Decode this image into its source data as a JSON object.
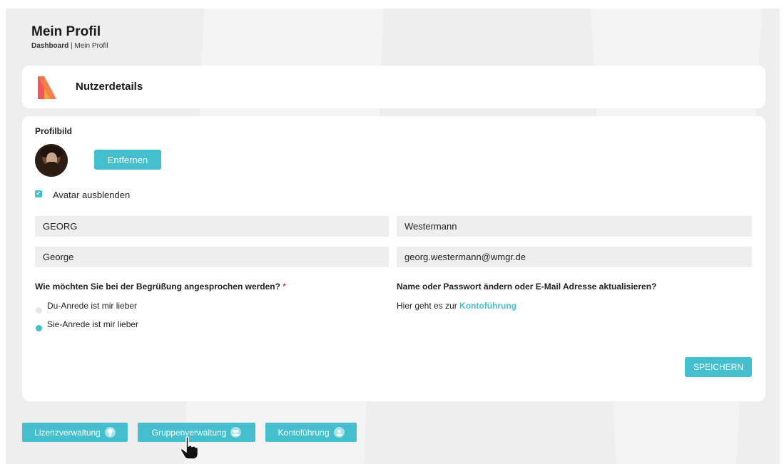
{
  "header": {
    "title": "Mein Profil",
    "breadcrumb_link": "Dashboard",
    "breadcrumb_sep": " | ",
    "breadcrumb_current": "Mein Profil"
  },
  "section_card": {
    "title": "Nutzerdetails"
  },
  "profile": {
    "picture_label": "Profilbild",
    "remove_button": "Entfernen",
    "hide_avatar_label": "Avatar ausblenden",
    "hide_avatar_checked": true
  },
  "fields": {
    "first_name": "GEORG",
    "last_name": "Westermann",
    "display_name": "George",
    "email": "georg.westermann@wmgr.de"
  },
  "salutation": {
    "question": "Wie möchten Sie bei der Begrüßung angesprochen werden?",
    "required_mark": "*",
    "options": [
      {
        "label": "Du-Anrede ist mir lieber",
        "selected": false
      },
      {
        "label": "Sie-Anrede ist mir lieber",
        "selected": true
      }
    ]
  },
  "account": {
    "question": "Name oder Passwort ändern oder E-Mail Adresse aktualisieren?",
    "text": "Hier geht es zur ",
    "link": "Kontoführung"
  },
  "save_button": "SPEICHERN",
  "bottom_nav": [
    {
      "label": "Lizenzverwaltung",
      "icon": "lightbulb-icon"
    },
    {
      "label": "Gruppenverwaltung",
      "icon": "group-icon"
    },
    {
      "label": "Kontoführung",
      "icon": "user-icon"
    }
  ],
  "colors": {
    "accent": "#45bfce",
    "required": "#e0463b",
    "background": "#eeeeee"
  }
}
